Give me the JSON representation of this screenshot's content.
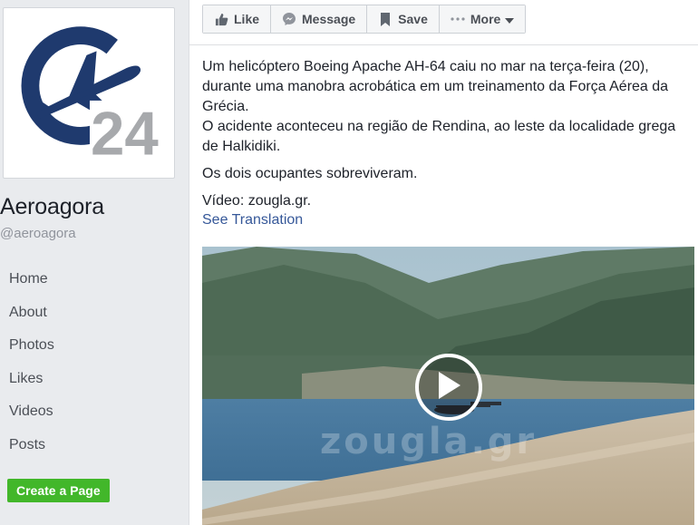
{
  "page": {
    "name": "Aeroagora",
    "handle": "@aeroagora",
    "logo_text": "24"
  },
  "nav": {
    "items": [
      {
        "label": "Home"
      },
      {
        "label": "About"
      },
      {
        "label": "Photos"
      },
      {
        "label": "Likes"
      },
      {
        "label": "Videos"
      },
      {
        "label": "Posts"
      }
    ],
    "create_page_label": "Create a Page"
  },
  "actions": {
    "like": {
      "label": "Like",
      "icon": "thumbs-up-icon"
    },
    "message": {
      "label": "Message",
      "icon": "messenger-icon"
    },
    "save": {
      "label": "Save",
      "icon": "bookmark-icon"
    },
    "more": {
      "label": "More",
      "icon": "ellipsis-icon"
    }
  },
  "post": {
    "paragraph1_line1": "Um helicóptero Boeing Apache AH-64 caiu no mar na terça-feira (20),",
    "paragraph1_line2": "durante uma manobra acrobática em um treinamento da Força Aérea da",
    "paragraph1_line3": "Grécia.",
    "paragraph1_line4": "O acidente aconteceu na região de Rendina, ao leste da localidade grega",
    "paragraph1_line5": "de Halkidiki.",
    "paragraph2": "Os dois ocupantes sobreviveram.",
    "paragraph3": "Vídeo: zougla.gr.",
    "see_translation": "See Translation"
  },
  "video": {
    "watermark": "zougla.gr"
  },
  "colors": {
    "background": "#e9ebee",
    "link": "#365899",
    "create_button": "#42b72a",
    "logo_blue": "#1f3a6e",
    "logo_gray": "#a7a9ac"
  }
}
